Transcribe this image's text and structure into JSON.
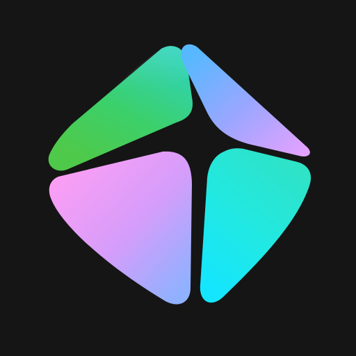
{
  "icon": {
    "name": "app-logo",
    "background_color": "#151515",
    "petals": [
      {
        "name": "top-left-petal",
        "colors": [
          "#2fd3b9",
          "#3cd06a",
          "#4fc94a"
        ]
      },
      {
        "name": "top-right-petal",
        "colors": [
          "#58b8ff",
          "#9aa6ff",
          "#e2a2ff"
        ]
      },
      {
        "name": "bottom-left-petal",
        "colors": [
          "#ff9ef4",
          "#d59dfa",
          "#8fb1ff"
        ]
      },
      {
        "name": "bottom-right-petal",
        "colors": [
          "#30e2c4",
          "#22e8e0",
          "#14e6ff"
        ]
      }
    ]
  }
}
